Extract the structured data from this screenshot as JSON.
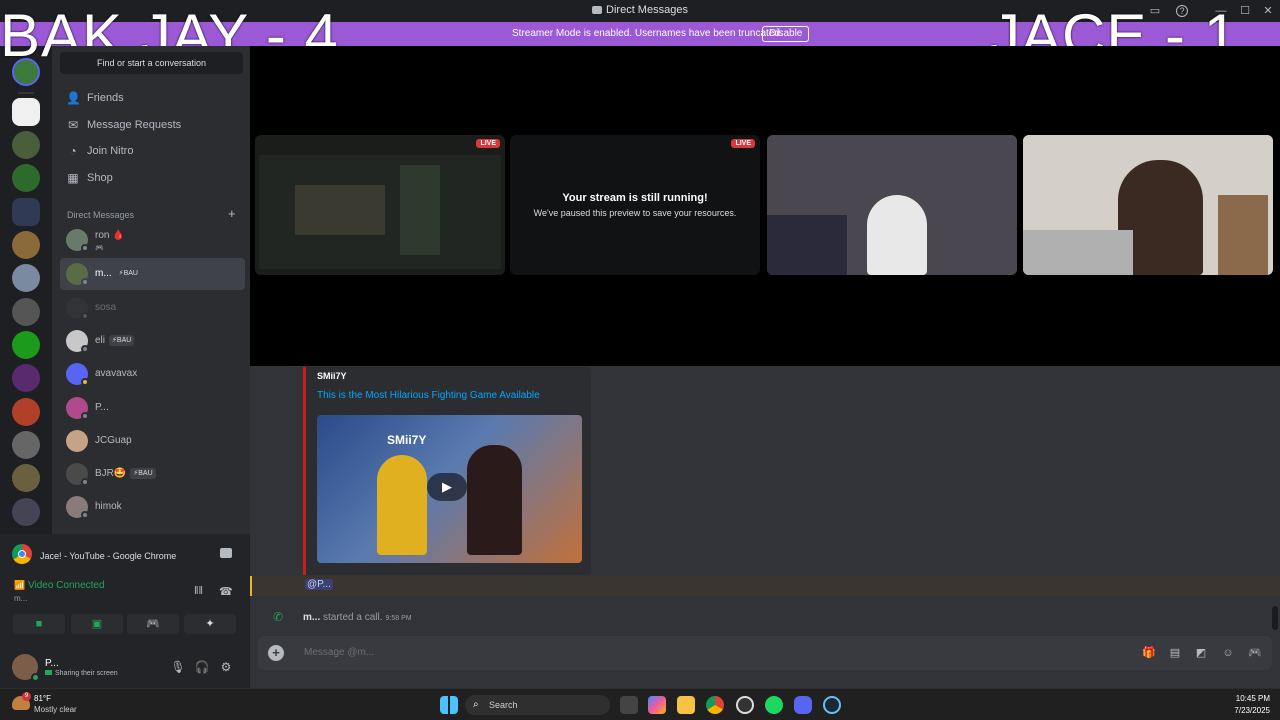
{
  "window": {
    "title": "Direct Messages"
  },
  "banner": {
    "message": "Streamer Mode is enabled. Usernames have been truncated.",
    "disable_label": "Disable"
  },
  "overlays": {
    "left": "BAK JAY - 4",
    "right": "JACE - 1"
  },
  "sidebar": {
    "search_placeholder": "Find or start a conversation",
    "nav": [
      {
        "label": "Friends",
        "icon": "friends-icon"
      },
      {
        "label": "Message Requests",
        "icon": "mail-icon"
      },
      {
        "label": "Join Nitro",
        "icon": "nitro-icon"
      },
      {
        "label": "Shop",
        "icon": "shop-icon"
      }
    ],
    "dm_header": "Direct Messages",
    "dms": [
      {
        "name": "ron 🩸",
        "badge": "",
        "sub": "🎮"
      },
      {
        "name": "m...",
        "badge": "⚡BAU",
        "sub": ""
      },
      {
        "name": "sosa",
        "badge": "",
        "sub": ""
      },
      {
        "name": "eli",
        "badge": "⚡BAU",
        "sub": ""
      },
      {
        "name": "avavavax",
        "badge": "",
        "sub": ""
      },
      {
        "name": "P...",
        "badge": "",
        "sub": ""
      },
      {
        "name": "JCGuap",
        "badge": "",
        "sub": ""
      },
      {
        "name": "BJR🤩",
        "badge": "⚡BAU",
        "sub": ""
      },
      {
        "name": "himok",
        "badge": "",
        "sub": ""
      }
    ]
  },
  "voice": {
    "share_title": "Jace! - YouTube - Google Chrome",
    "status": "Video Connected",
    "channel": "m...",
    "user_name": "P...",
    "user_status": "Sharing their screen"
  },
  "call": {
    "live_label": "LIVE",
    "paused_title": "Your stream is still running!",
    "paused_sub": "We've paused this preview to save your resources."
  },
  "chat": {
    "embed_author": "SMii7Y",
    "embed_title": "This is the Most Hilarious Fighting Game Available",
    "thumb_text": "SMii7Y",
    "mention": "@P...",
    "call_user": "m...",
    "call_text": "started a call.",
    "call_time": "9:58 PM",
    "composer_placeholder": "Message @m..."
  },
  "taskbar": {
    "weather_temp": "81°F",
    "weather_desc": "Mostly clear",
    "weather_badge": "9",
    "search_label": "Search",
    "time": "10:45 PM",
    "date": "7/23/2025"
  },
  "colors": {
    "accent": "#5865f2",
    "online": "#23a55a",
    "banner": "#9b59d6",
    "live": "#da373c"
  }
}
